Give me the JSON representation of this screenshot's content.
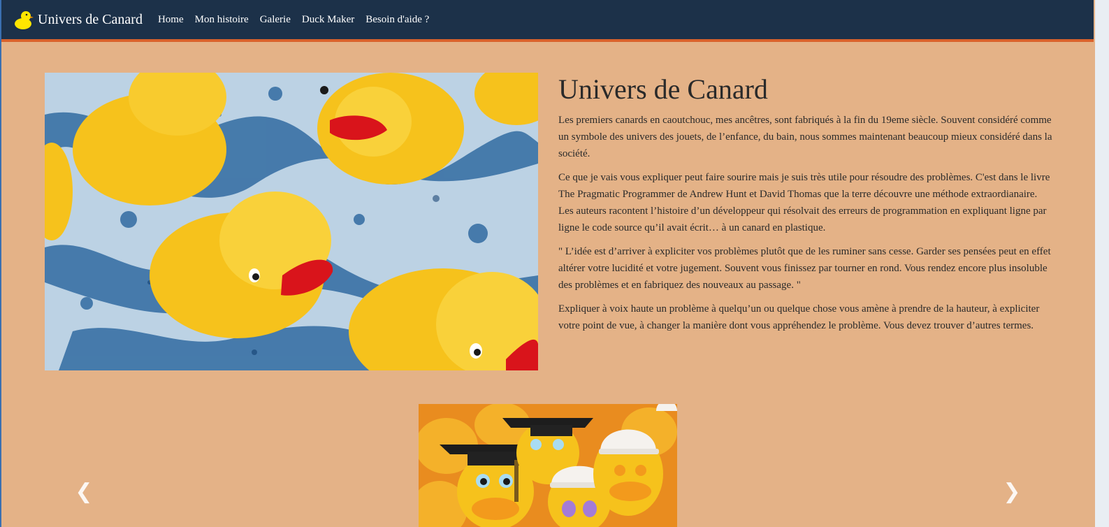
{
  "navbar": {
    "brand_icon": "duck-icon",
    "brand_text": "Univers de Canard",
    "links": [
      "Home",
      "Mon histoire",
      "Galerie",
      "Duck Maker",
      "Besoin d'aide ?"
    ]
  },
  "hero": {
    "image_subject": "rubber-ducks-in-water-photo"
  },
  "content": {
    "title": "Univers de Canard",
    "paragraphs": [
      "Les premiers canards en caoutchouc, mes ancêtres, sont fabriqués à la fin du 19eme siècle. Souvent considéré comme un symbole des univers des jouets, de l’enfance, du bain, nous sommes maintenant beaucoup mieux considéré dans la société.",
      "Ce que je vais vous expliquer peut faire sourire mais je suis très utile pour résoudre des problèmes. C'est dans le livre The Pragmatic Programmer de Andrew Hunt et David Thomas que la terre découvre une méthode extraordianaire. Les auteurs racontent l’histoire d’un développeur qui résolvait des erreurs de programmation en expliquant ligne par ligne le code source qu’il avait écrit… à un canard en plastique.",
      "\" L’idée est d’arriver à expliciter vos problèmes plutôt que de les ruminer sans cesse. Garder ses pensées peut en effet altérer votre lucidité et votre jugement. Souvent vous finissez par tourner en rond. Vous rendez encore plus insoluble des problèmes et en fabriquez des nouveaux au passage. \"",
      "Expliquer à voix haute un problème à quelqu’un ou quelque chose vous amène à prendre de la hauteur, à expliciter votre point de vue, à changer la manière dont vous appréhendez le problème. Vous devez trouver d’autres termes."
    ]
  },
  "carousel": {
    "slide_subject": "graduate-and-builder-rubber-ducks-photo",
    "prev_icon": "chevron-left-icon",
    "next_icon": "chevron-right-icon",
    "prev_glyph": "❮",
    "next_glyph": "❯"
  },
  "colors": {
    "page_background": "#e4b287",
    "navbar_background": "#1c3149",
    "navbar_accent": "#d9622b",
    "duck_yellow": "#f6c21c"
  }
}
